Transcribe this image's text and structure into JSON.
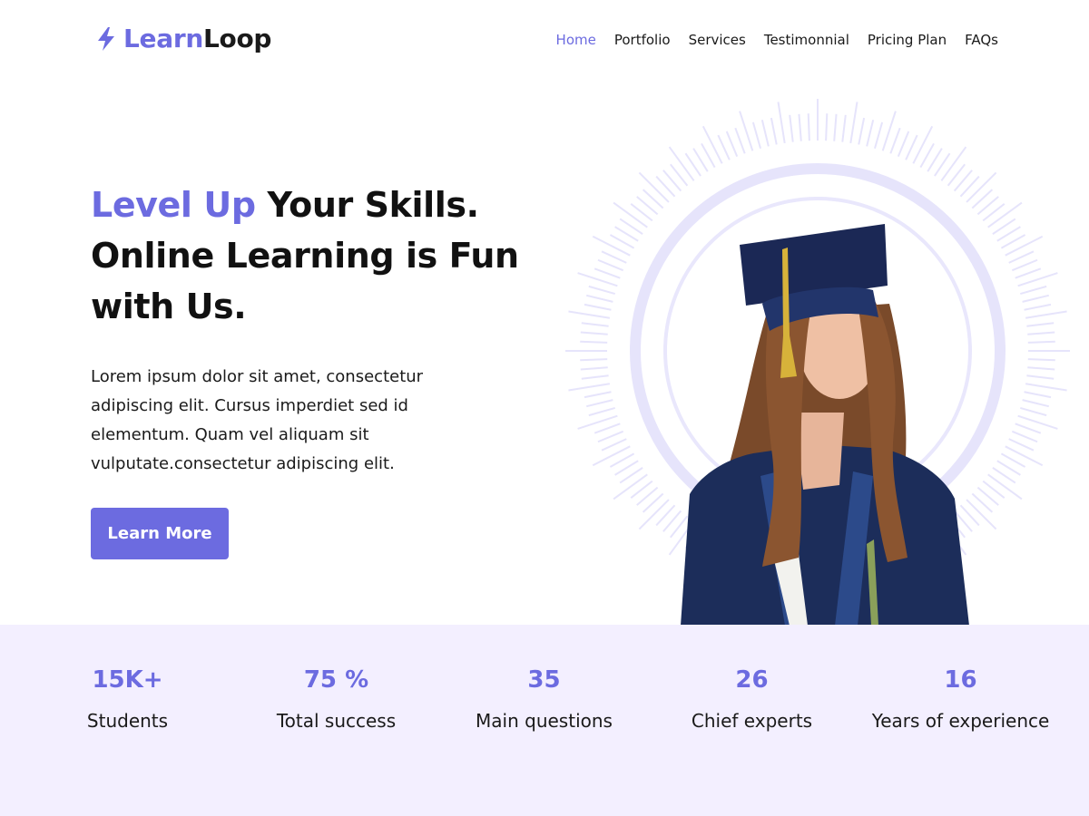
{
  "brand": {
    "name_part1": "Learn",
    "name_part2": "Loop",
    "icon": "bolt-icon"
  },
  "nav": {
    "items": [
      {
        "label": "Home",
        "active": true
      },
      {
        "label": "Portfolio",
        "active": false
      },
      {
        "label": "Services",
        "active": false
      },
      {
        "label": "Testimonnial",
        "active": false
      },
      {
        "label": "Pricing Plan",
        "active": false
      },
      {
        "label": "FAQs",
        "active": false
      }
    ]
  },
  "hero": {
    "title_accent": "Level Up",
    "title_rest_1": " Your Skills.",
    "title_line_2": "Online Learning is Fun",
    "title_line_3": "with Us.",
    "description": "Lorem ipsum dolor sit amet, consectetur adipiscing elit. Cursus imperdiet sed id elementum. Quam vel aliquam sit vulputate.consectetur adipiscing elit.",
    "cta_label": "Learn More",
    "image": "graduate-student-photo"
  },
  "stats": [
    {
      "value": "15K+",
      "label": "Students"
    },
    {
      "value": "75 %",
      "label": "Total success"
    },
    {
      "value": "35",
      "label": "Main questions"
    },
    {
      "value": "26",
      "label": "Chief experts"
    },
    {
      "value": "16",
      "label": "Years of experience"
    }
  ],
  "colors": {
    "accent": "#6c6be0",
    "text": "#111111",
    "stats_background": "#f3efff",
    "ring": "#e6e4fb"
  }
}
